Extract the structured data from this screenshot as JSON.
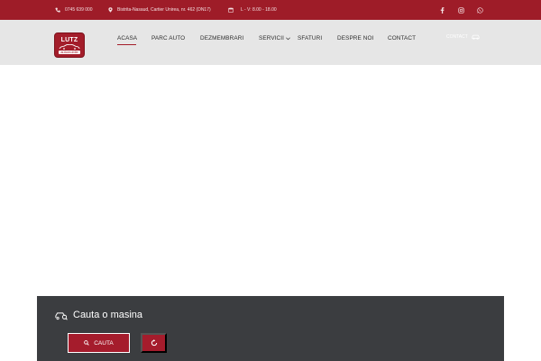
{
  "topbar": {
    "phone": "0745 639 000",
    "address": "Bistrita-Nasaud, Cartier Unirea, nr. 462 (DN17)",
    "hours": "L - V: 8.00 - 18.00",
    "social": [
      "facebook-icon",
      "instagram-icon",
      "whatsapp-icon"
    ]
  },
  "logo": {
    "line1": "LUTZ",
    "line2": "automobile"
  },
  "nav": {
    "items": [
      "ACASA",
      "PARC AUTO",
      "DEZMEMBRARI",
      "SERVICII",
      "SFATURI",
      "DESPRE NOI",
      "CONTACT"
    ],
    "active": "ACASA"
  },
  "header": {
    "contact_link": "CONTACT"
  },
  "search": {
    "title": "Cauta o masina",
    "search_button": "CAUTA",
    "reset_button_icon": "refresh-icon"
  },
  "colors": {
    "brand_red": "#9e1c28",
    "header_bg": "#e6e6e6",
    "panel_bg": "#3b3d40"
  }
}
